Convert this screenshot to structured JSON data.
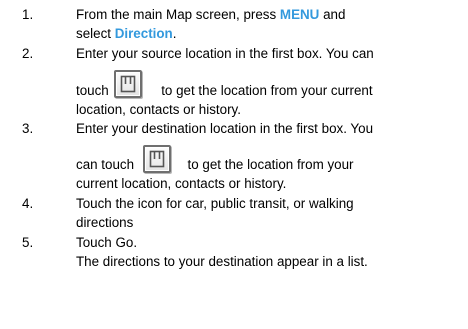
{
  "steps": [
    {
      "number": "1.",
      "line1_prefix": "From the main Map screen, press ",
      "menu_keyword": "MENU",
      "line1_suffix": " and",
      "line2_prefix": "select ",
      "direction_keyword": "Direction",
      "line2_suffix": "."
    },
    {
      "number": "2.",
      "line1": "Enter your source location in the first box. You can",
      "line2_prefix": "touch ",
      "line2_suffix": " to get the location from your current",
      "line3": "location, contacts or history.",
      "icon": "contact-picker-icon"
    },
    {
      "number": "3.",
      "line1": "Enter your destination location in the first box. You",
      "line2_prefix": "can touch ",
      "line2_suffix": " to get the location from your",
      "line3": "current location, contacts or history.",
      "icon": "contact-picker-icon"
    },
    {
      "number": "4.",
      "line1": "Touch the icon for car, public transit, or walking",
      "line2": "directions"
    },
    {
      "number": "5.",
      "line1": "Touch Go.",
      "line2": "The directions to your destination appear in a list."
    }
  ],
  "colors": {
    "keyword": "#3399dd",
    "text": "#000000"
  }
}
